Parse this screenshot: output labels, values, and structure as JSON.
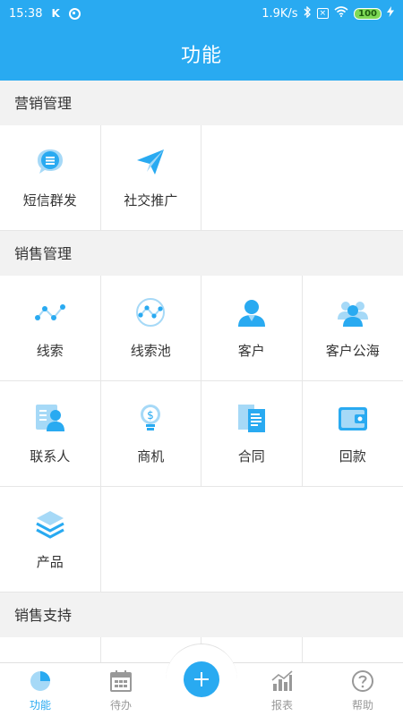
{
  "status_bar": {
    "time": "15:38",
    "left_icons": [
      "k-icon",
      "p-icon"
    ],
    "net_speed": "1.9K/s",
    "battery": "100"
  },
  "header": {
    "title": "功能"
  },
  "sections": [
    {
      "title": "营销管理",
      "items": [
        {
          "label": "短信群发",
          "icon": "sms-bubble-icon"
        },
        {
          "label": "社交推广",
          "icon": "paper-plane-icon"
        }
      ]
    },
    {
      "title": "销售管理",
      "items": [
        {
          "label": "线索",
          "icon": "trend-line-icon"
        },
        {
          "label": "线索池",
          "icon": "trend-pool-icon"
        },
        {
          "label": "客户",
          "icon": "customer-icon"
        },
        {
          "label": "客户公海",
          "icon": "customer-group-icon"
        },
        {
          "label": "联系人",
          "icon": "contact-card-icon"
        },
        {
          "label": "商机",
          "icon": "lightbulb-money-icon"
        },
        {
          "label": "合同",
          "icon": "documents-icon"
        },
        {
          "label": "回款",
          "icon": "wallet-icon"
        },
        {
          "label": "产品",
          "icon": "layers-icon"
        }
      ]
    },
    {
      "title": "销售支持",
      "items": []
    }
  ],
  "bottom_nav": {
    "items": [
      {
        "label": "功能",
        "icon": "pie-chart-icon",
        "active": true
      },
      {
        "label": "待办",
        "icon": "calendar-icon",
        "active": false
      },
      {
        "label": "报表",
        "icon": "bar-chart-icon",
        "active": false
      },
      {
        "label": "帮助",
        "icon": "help-icon",
        "active": false
      }
    ],
    "center_icon": "plus-icon"
  },
  "colors": {
    "primary": "#29aaf1",
    "icon_light": "#a6d9f7",
    "text": "#333333",
    "inactive": "#999999"
  }
}
